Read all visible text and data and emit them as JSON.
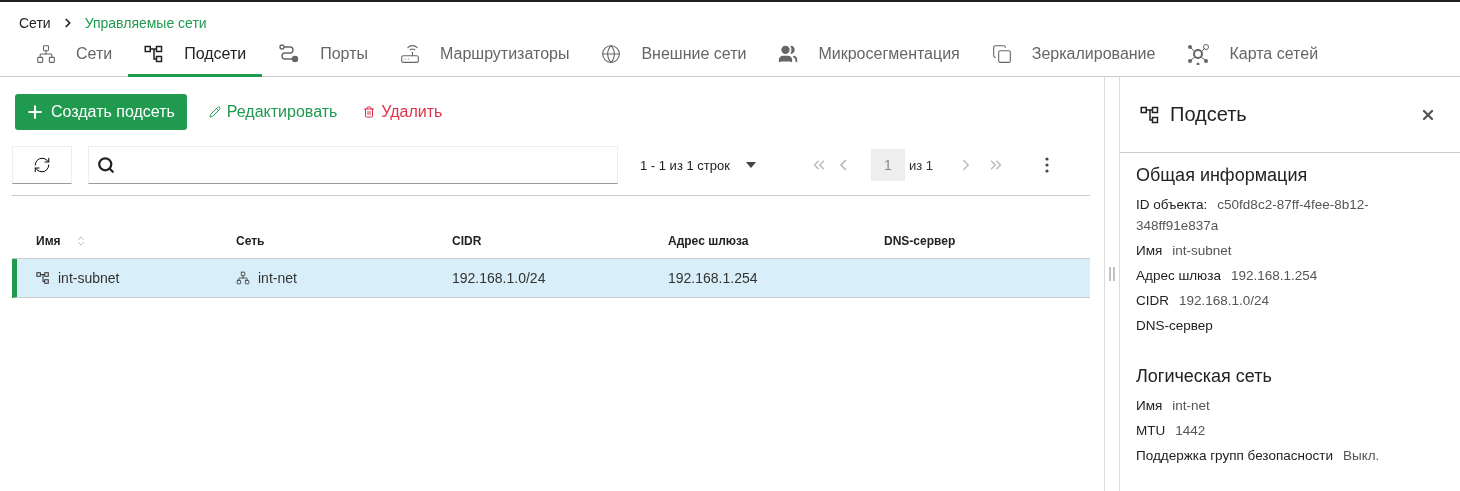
{
  "breadcrumb": [
    {
      "label": "Сети",
      "current": false
    },
    {
      "label": "Управляемые сети",
      "current": true
    }
  ],
  "tabs": [
    {
      "label": "Сети",
      "selected": false
    },
    {
      "label": "Подсети",
      "selected": true
    },
    {
      "label": "Порты",
      "selected": false
    },
    {
      "label": "Маршрутизаторы",
      "selected": false
    },
    {
      "label": "Внешние сети",
      "selected": false
    },
    {
      "label": "Микросегментация",
      "selected": false
    },
    {
      "label": "Зеркалирование",
      "selected": false
    },
    {
      "label": "Карта сетей",
      "selected": false
    }
  ],
  "actions": [
    {
      "label": "Создать подсеть",
      "kind": "primary"
    },
    {
      "label": "Редактировать",
      "kind": "edit"
    },
    {
      "label": "Удалить",
      "kind": "delete"
    }
  ],
  "pagination": {
    "range": "1 - 1 из 1 строк",
    "page": "1",
    "total": "из 1"
  },
  "table": {
    "columns": [
      {
        "label": "Имя",
        "kind": "subnet",
        "sortable": true
      },
      {
        "label": "Сеть",
        "kind": "network",
        "sortable": false
      },
      {
        "label": "CIDR",
        "kind": "text",
        "sortable": false
      },
      {
        "label": "Адрес шлюза",
        "kind": "text",
        "sortable": false
      },
      {
        "label": "DNS-сервер",
        "kind": "text",
        "sortable": false
      }
    ],
    "rows": [
      {
        "cells": [
          "int-subnet",
          "int-net",
          "192.168.1.0/24",
          "192.168.1.254",
          null
        ],
        "selected": true
      }
    ]
  },
  "panel": {
    "title": "Подсеть",
    "sections": [
      {
        "title": "Общая информация",
        "fields": [
          {
            "label": "ID объекта:",
            "value": "c50fd8c2-87ff-4fee-8b12-348ff91e837a"
          },
          {
            "label": "Имя",
            "value": "int-subnet"
          },
          {
            "label": "Адрес шлюза",
            "value": "192.168.1.254"
          },
          {
            "label": "CIDR",
            "value": "192.168.1.0/24"
          },
          {
            "label": "DNS-сервер"
          }
        ]
      },
      {
        "title": "Логическая сеть",
        "fields": [
          {
            "label": "Имя",
            "value": "int-net"
          },
          {
            "label": "MTU",
            "value": "1442"
          },
          {
            "label": "Поддержка групп безопасности",
            "value": "Выкл."
          }
        ]
      }
    ]
  }
}
